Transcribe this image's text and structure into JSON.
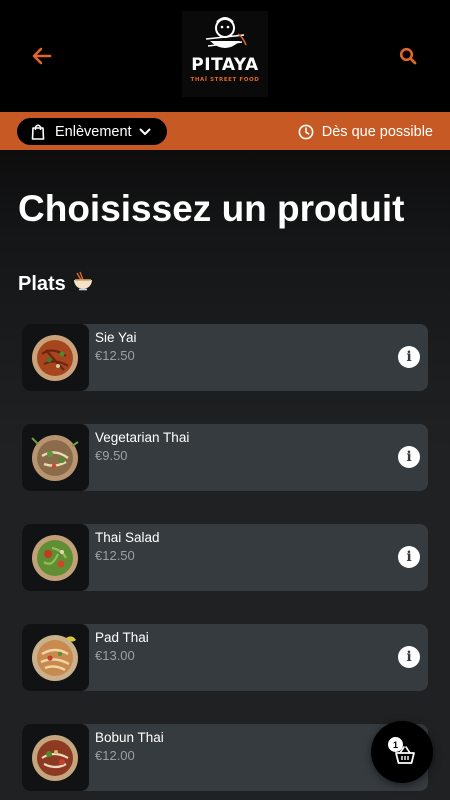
{
  "header": {
    "brand_name": "PITAYA",
    "brand_tagline": "THAÏ STREET FOOD",
    "accent_color": "#c75a24"
  },
  "order_bar": {
    "mode_label": "Enlèvement",
    "time_label": "Dès que possible"
  },
  "page": {
    "title": "Choisissez un produit"
  },
  "section": {
    "title": "Plats",
    "emoji": "🍜"
  },
  "products": [
    {
      "name": "Sie Yai",
      "price": "€12.50"
    },
    {
      "name": "Vegetarian Thai",
      "price": "€9.50"
    },
    {
      "name": "Thai Salad",
      "price": "€12.50"
    },
    {
      "name": "Pad Thai",
      "price": "€13.00"
    },
    {
      "name": "Bobun Thai",
      "price": "€12.00"
    }
  ],
  "cart": {
    "count": "1"
  },
  "icons": {
    "back": "arrow-left-icon",
    "search": "search-icon",
    "bag": "shopping-bag-icon",
    "chevron": "chevron-down-icon",
    "clock": "clock-icon",
    "info": "info-icon",
    "basket": "basket-icon"
  }
}
